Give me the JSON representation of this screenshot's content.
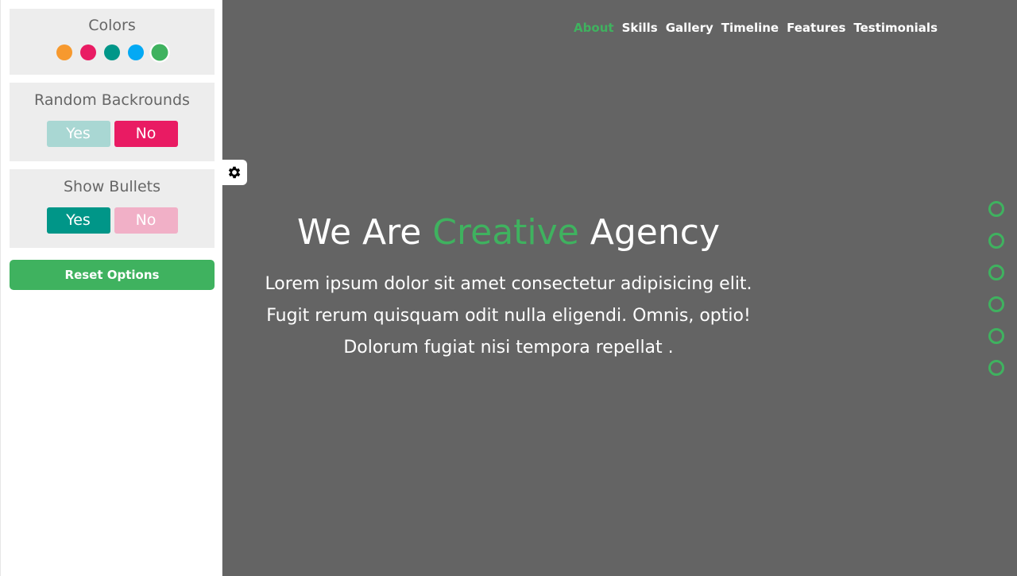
{
  "settings": {
    "colors_title": "Colors",
    "colors": [
      "#f7992e",
      "#e91b63",
      "#009688",
      "#03a9f4",
      "#3fb25f"
    ],
    "active_color": "#3fb25f",
    "random_bg_title": "Random Backrounds",
    "random_bg": {
      "yes_label": "Yes",
      "no_label": "No",
      "selected": "No"
    },
    "show_bullets_title": "Show Bullets",
    "show_bullets": {
      "yes_label": "Yes",
      "no_label": "No",
      "selected": "Yes"
    },
    "reset_label": "Reset Options"
  },
  "gear_icon": "gear-icon",
  "nav": {
    "items": [
      "About",
      "Skills",
      "Gallery",
      "Timeline",
      "Features",
      "Testimonials"
    ],
    "active": "About"
  },
  "hero": {
    "title_before": "We Are",
    "title_accent": "Creative",
    "title_after": "Agency",
    "lines": [
      "Lorem ipsum dolor sit amet consectetur adipisicing elit.",
      "Fugit rerum quisquam odit nulla eligendi. Omnis, optio!",
      "Dolorum fugiat nisi tempora repellat ."
    ]
  },
  "bullets": {
    "count": 6
  },
  "accent_color": "#3fb25f"
}
